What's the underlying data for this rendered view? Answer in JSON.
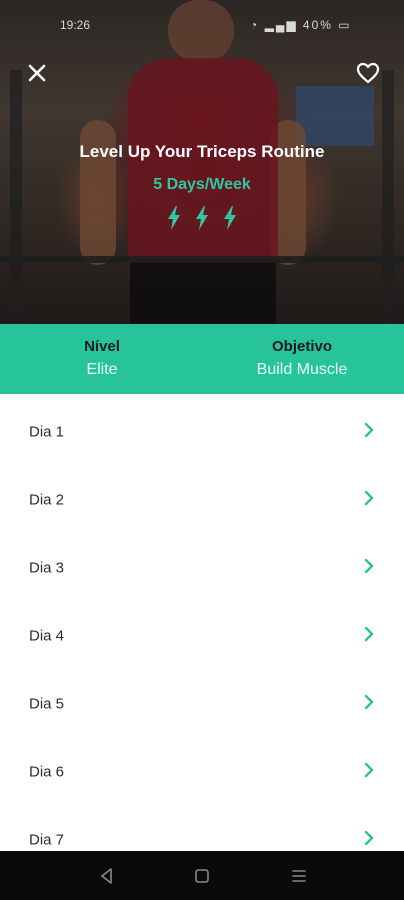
{
  "status_bar": {
    "time": "19:26",
    "battery": "40%"
  },
  "hero": {
    "title": "Level Up Your Triceps Routine",
    "frequency": "5 Days/Week",
    "intensity_bolts": 3,
    "accent_color": "#2fc6a0"
  },
  "info": {
    "level_label": "Nível",
    "level_value": "Elite",
    "goal_label": "Objetivo",
    "goal_value": "Build Muscle",
    "band_color": "#27c39a"
  },
  "days": [
    {
      "label": "Dia 1"
    },
    {
      "label": "Dia 2"
    },
    {
      "label": "Dia 3"
    },
    {
      "label": "Dia 4"
    },
    {
      "label": "Dia 5"
    },
    {
      "label": "Dia 6"
    },
    {
      "label": "Dia 7"
    }
  ],
  "icons": {
    "close": "close-icon",
    "favorite": "heart-outline-icon",
    "bolt": "lightning-bolt-icon",
    "chevron": "chevron-right-icon",
    "nav_back": "triangle-back-icon",
    "nav_home": "square-home-icon",
    "nav_menu": "three-lines-menu-icon"
  }
}
